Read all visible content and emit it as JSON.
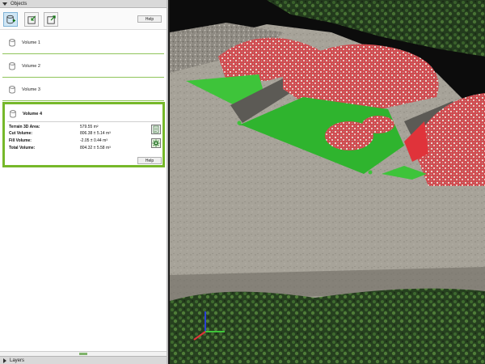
{
  "panel": {
    "title": "Objects",
    "help_label": "Help"
  },
  "toolbar": {
    "buttons": [
      "new-volume-icon",
      "import-volume-icon",
      "export-volume-icon"
    ]
  },
  "volumes": [
    {
      "label": "Volume 1"
    },
    {
      "label": "Volume 2"
    },
    {
      "label": "Volume 3"
    }
  ],
  "selected_volume": {
    "label": "Volume 4",
    "rows": [
      {
        "key": "Terrain 3D Area:",
        "value": "579.55",
        "unit": "m²"
      },
      {
        "key": "Cut Volume:",
        "value": "806.38",
        "pm": "5.14",
        "unit": "m³"
      },
      {
        "key": "Fill Volume:",
        "value": "-2.05",
        "pm": "0.44",
        "unit": "m³"
      },
      {
        "key": "Total Volume:",
        "value": "804.32",
        "pm": "5.58",
        "unit": "m³"
      }
    ],
    "help_label": "Help"
  },
  "layers_panel": {
    "title": "Layers"
  },
  "colors": {
    "accent": "#76b82a",
    "fill_green": "#3ec43a",
    "cut_red": "#e0333a"
  }
}
